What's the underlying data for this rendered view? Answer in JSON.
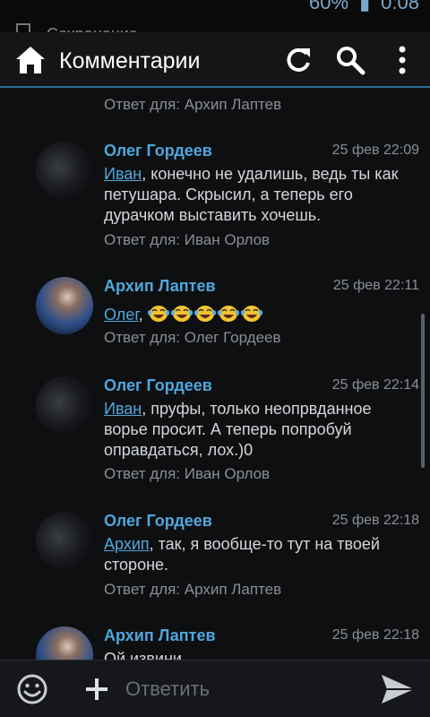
{
  "status": {
    "battery": "60%",
    "time": "0:08"
  },
  "notification": {
    "text": "Сохранение"
  },
  "header": {
    "title": "Комментарии"
  },
  "top_reply": "Ответ для: Архип Лаптев",
  "comments": [
    {
      "author": "Олег Гордеев",
      "date": "25 фев 22:09",
      "mention": "Иван",
      "text": ", конечно не удалишь, ведь ты как петушара. Скрысил, а теперь его дурачком выставить хочешь.",
      "reply": "Ответ для: Иван Орлов"
    },
    {
      "author": "Архип Лаптев",
      "date": "25 фев 22:11",
      "mention": "Олег",
      "text": ", ",
      "reply": "Ответ для: Олег Гордеев"
    },
    {
      "author": "Олег Гордеев",
      "date": "25 фев 22:14",
      "mention": "Иван",
      "text": ", пруфы, только неопрвданное ворье просит. А теперь попробуй оправдаться, лох.)0",
      "reply": "Ответ для: Иван Орлов"
    },
    {
      "author": "Олег Гордеев",
      "date": "25 фев 22:18",
      "mention": "Архип",
      "text": ", так, я вообще-то тут на твоей стороне.",
      "reply": "Ответ для: Архип Лаптев"
    },
    {
      "author": "Архип Лаптев",
      "date": "25 фев 22:18",
      "text": "Ой извини"
    }
  ],
  "input": {
    "placeholder": "Ответить"
  },
  "colors": {
    "accent": "#4fa7dd",
    "divider": "#2c6e95"
  }
}
